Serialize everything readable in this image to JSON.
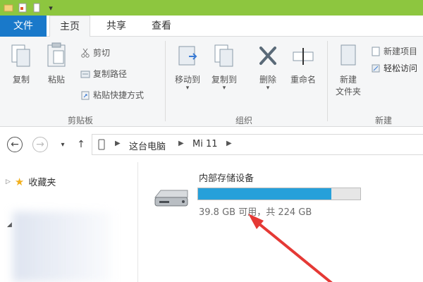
{
  "tabs": {
    "file": "文件",
    "home": "主页",
    "share": "共享",
    "view": "查看"
  },
  "ribbon": {
    "clipboard": {
      "label": "剪贴板",
      "copy": "复制",
      "paste": "粘贴",
      "cut": "剪切",
      "copy_path": "复制路径",
      "paste_shortcut": "粘贴快捷方式"
    },
    "organize": {
      "label": "组织",
      "move_to": "移动到",
      "copy_to": "复制到",
      "delete": "删除",
      "rename": "重命名"
    },
    "new": {
      "label": "新建",
      "new_folder_line1": "新建",
      "new_folder_line2": "文件夹",
      "new_item": "新建项目",
      "easy_access": "轻松访问"
    }
  },
  "address": {
    "this_pc": "这台电脑",
    "device": "Mi 11"
  },
  "nav": {
    "favorites": "收藏夹"
  },
  "drive": {
    "name": "内部存储设备",
    "space": "39.8 GB 可用，共 224 GB",
    "used_fraction": 0.822
  },
  "colors": {
    "titlebar": "#8dc63f",
    "file_tab": "#1979ca",
    "progress": "#26a0da",
    "annotation": "#e53935"
  }
}
